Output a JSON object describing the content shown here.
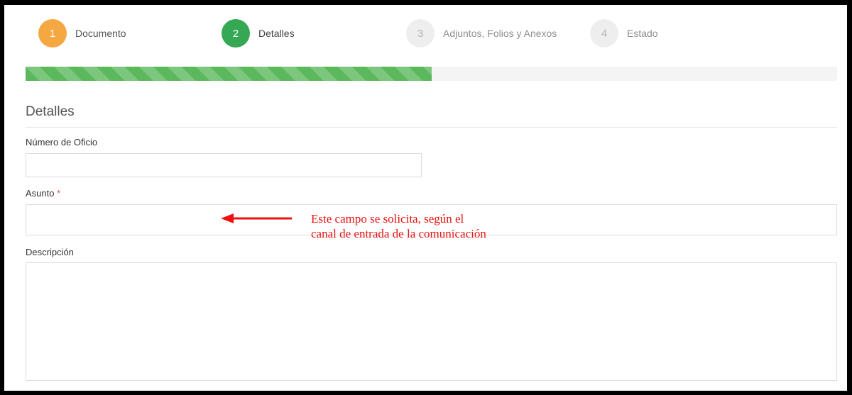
{
  "wizard": {
    "steps": [
      {
        "number": "1",
        "label": "Documento",
        "color": "#f5a742"
      },
      {
        "number": "2",
        "label": "Detalles",
        "color": "#34a853"
      },
      {
        "number": "3",
        "label": "Adjuntos, Folios y Anexos",
        "color": "#eeeeee"
      },
      {
        "number": "4",
        "label": "Estado",
        "color": "#eeeeee"
      }
    ],
    "progress_fraction": 0.5
  },
  "form": {
    "section_title": "Detalles",
    "numero_oficio_label": "Número de Oficio",
    "numero_oficio_value": "",
    "asunto_label": "Asunto",
    "asunto_required_mark": "*",
    "asunto_value": "",
    "descripcion_label": "Descripción",
    "descripcion_value": ""
  },
  "annotation": {
    "line1": "Este campo se solicita, según el",
    "line2": "canal de entrada de la comunicación",
    "color": "#ee1111"
  }
}
